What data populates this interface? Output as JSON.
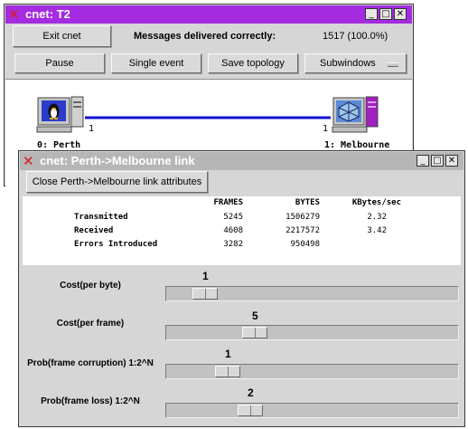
{
  "main_window": {
    "title": "cnet: T2",
    "exit_button": "Exit cnet",
    "messages_label": "Messages delivered correctly:",
    "messages_value": "1517 (100.0%)",
    "toolbar": {
      "pause": "Pause",
      "single_event": "Single event",
      "save_topology": "Save topology",
      "subwindows": "Subwindows"
    },
    "nodes": [
      {
        "label": "0: Perth",
        "link_number": "1",
        "icon": "linux-penguin-computer-icon"
      },
      {
        "label": "1: Melbourne",
        "link_number": "1",
        "icon": "router-computer-icon"
      }
    ],
    "link_color": "#1010d0"
  },
  "link_window": {
    "title": "cnet: Perth->Melbourne link",
    "close_button": "Close Perth->Melbourne link attributes",
    "stats": {
      "headers": [
        "FRAMES",
        "BYTES",
        "KBytes/sec"
      ],
      "rows": [
        {
          "label": "Transmitted",
          "frames": "5245",
          "bytes": "1506279",
          "kbytes": "2.32"
        },
        {
          "label": "Received",
          "frames": "4608",
          "bytes": "2217572",
          "kbytes": "3.42"
        },
        {
          "label": "Errors Introduced",
          "frames": "3282",
          "bytes": "950498",
          "kbytes": ""
        }
      ]
    },
    "sliders": [
      {
        "label": "Cost(per byte)",
        "value": "1"
      },
      {
        "label": "Cost(per frame)",
        "value": "5"
      },
      {
        "label": "Prob(frame corruption) 1:2^N",
        "value": "1"
      },
      {
        "label": "Prob(frame loss) 1:2^N",
        "value": "2"
      }
    ]
  },
  "colors": {
    "active_titlebar": "#a42be0",
    "inactive_titlebar": "#b6b6b6",
    "window_bg": "#d6d6d6"
  }
}
